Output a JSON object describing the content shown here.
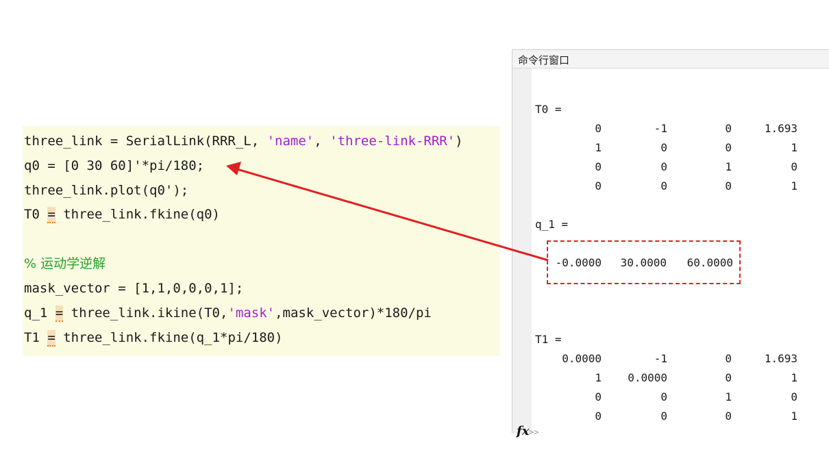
{
  "editor": {
    "lines": [
      {
        "a": "three_link = SerialLink(RRR_L, ",
        "s1": "'name'",
        "b": ", ",
        "s2": "'three-link-RRR'",
        "c": ")"
      },
      {
        "text": "q0 = [0 30 60]'*pi/180;"
      },
      {
        "text": "three_link.plot(q0');"
      },
      {
        "pre": "T0 ",
        "eq": "=",
        "post": " three_link.fkine(q0)"
      },
      {
        "comment": "% 运动学逆解"
      },
      {
        "text": "mask_vector = [1,1,0,0,0,1];"
      },
      {
        "pre": "q_1 ",
        "eq": "=",
        "mid": " three_link.ikine(T0,",
        "s": "'mask'",
        "post": ",mask_vector)*180/pi"
      },
      {
        "pre": "T1 ",
        "eq": "=",
        "post": " three_link.fkine(q_1*pi/180)"
      }
    ]
  },
  "command_window": {
    "title": "命令行窗口",
    "t0_label": "T0 =",
    "t0": [
      [
        "0",
        "-1",
        "0",
        "1.693"
      ],
      [
        "1",
        "0",
        "0",
        "1"
      ],
      [
        "0",
        "0",
        "1",
        "0"
      ],
      [
        "0",
        "0",
        "0",
        "1"
      ]
    ],
    "q1_label": "q_1 =",
    "q1": [
      "-0.0000",
      "30.0000",
      "60.0000"
    ],
    "t1_label": "T1 =",
    "t1": [
      [
        "0.0000",
        "-1",
        "0",
        "1.693"
      ],
      [
        "1",
        "0.0000",
        "0",
        "1"
      ],
      [
        "0",
        "0",
        "1",
        "0"
      ],
      [
        "0",
        "0",
        "0",
        "1"
      ]
    ],
    "prompt": "fx",
    "prompt_suffix": ">>"
  },
  "colors": {
    "annotation": "#e02020",
    "editor_bg": "#fbfbe2",
    "string": "#a31cd6",
    "comment": "#22a22a"
  }
}
